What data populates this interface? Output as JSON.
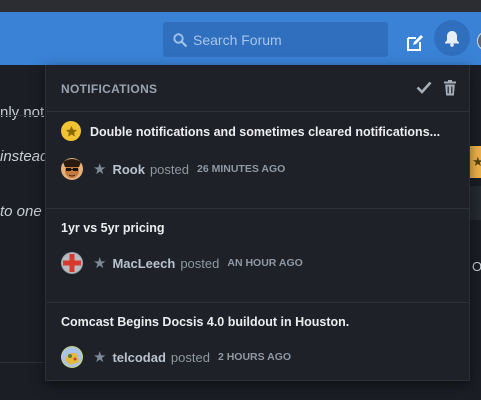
{
  "header": {
    "search": {
      "placeholder": "Search Forum",
      "icon": "search-icon"
    },
    "icons": [
      "edit-icon",
      "bell-icon",
      "avatar"
    ]
  },
  "background": {
    "fragments": [
      "nly not",
      "instead",
      "to one",
      "O"
    ]
  },
  "notifications": {
    "title": "NOTIFICATIONS",
    "actions": [
      "check-icon",
      "trash-icon"
    ],
    "items": [
      {
        "title": "Double notifications and sometimes cleared notifications...",
        "user": "Rook",
        "verb": "posted",
        "time": "26 MINUTES AGO",
        "unread": true
      },
      {
        "title": "1yr vs 5yr pricing",
        "user": "MacLeech",
        "verb": "posted",
        "time": "AN HOUR AGO",
        "unread": false
      },
      {
        "title": "Comcast Begins Docsis 4.0 buildout in Houston.",
        "user": "telcodad",
        "verb": "posted",
        "time": "2 HOURS AGO",
        "unread": false
      }
    ]
  },
  "colors": {
    "header": "#3a82d6",
    "panel_bg": "#1e2128",
    "unread_badge": "#f1c232",
    "accent_badge": "#f0b34b"
  }
}
